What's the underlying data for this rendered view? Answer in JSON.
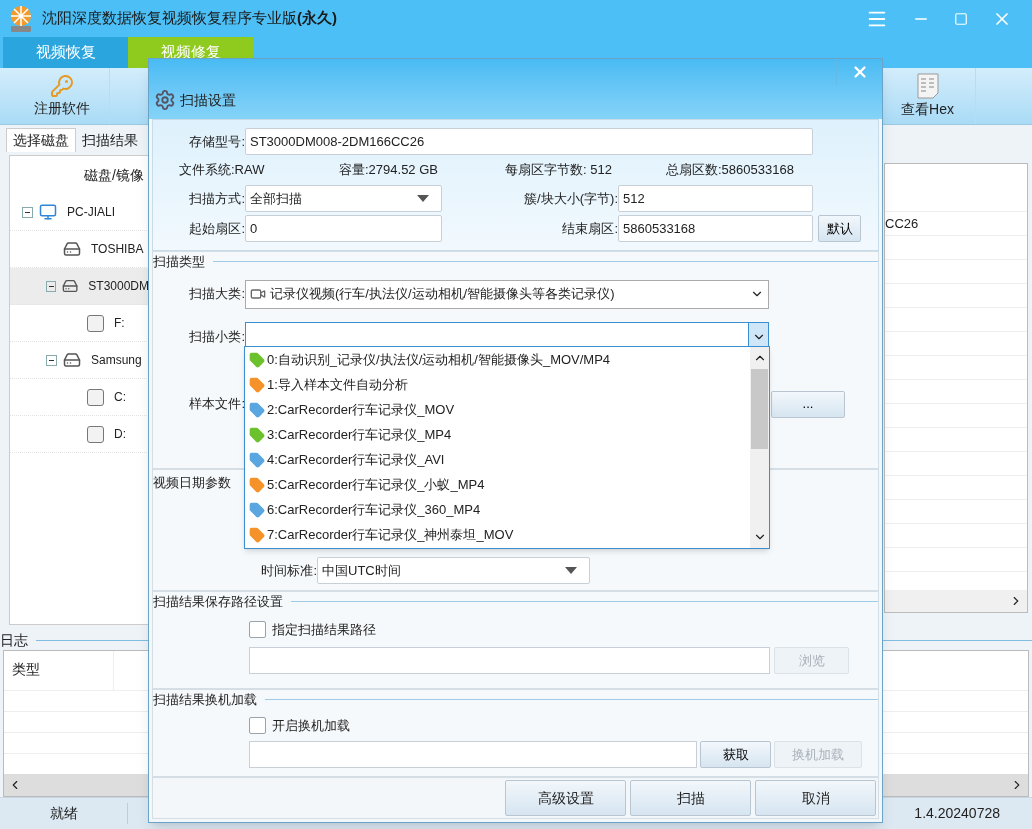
{
  "window": {
    "title": "沈阳深度数据恢复视频恢复程序专业版**(永久)**"
  },
  "main_tabs": [
    {
      "label": "视频恢复",
      "selected": false
    },
    {
      "label": "视频修复",
      "selected": true
    }
  ],
  "toolbar": [
    {
      "label": "注册软件",
      "kind": "keys"
    },
    {
      "label": "查看Hex",
      "kind": "hex"
    }
  ],
  "left_tabs": [
    {
      "label": "选择磁盘",
      "selected": true
    },
    {
      "label": "扫描结果",
      "selected": false
    }
  ],
  "tree": {
    "header": "磁盘/镜像",
    "items": [
      {
        "label": "PC-JIALI",
        "kind": "computer",
        "expanded": true,
        "selected": false,
        "children": [
          {
            "label": "TOSHIBA",
            "kind": "disk",
            "selected": false
          },
          {
            "label": "ST3000DM",
            "kind": "disk",
            "expanded": true,
            "selected": true,
            "children": [
              {
                "label": "F:",
                "kind": "volume",
                "selected": false
              }
            ]
          },
          {
            "label": "Samsung",
            "kind": "disk",
            "expanded": true,
            "selected": false,
            "children": [
              {
                "label": "C:",
                "kind": "volume",
                "selected": false
              },
              {
                "label": "D:",
                "kind": "volume",
                "selected": false
              }
            ]
          }
        ]
      }
    ]
  },
  "device_list": {
    "rows": [
      "CC26"
    ]
  },
  "log": {
    "title": "日志",
    "columns": [
      "类型"
    ]
  },
  "status_bar": {
    "status": "就绪",
    "version": "1.4.20240728"
  },
  "dialog": {
    "title": "扫描设置",
    "storage_model": {
      "label": "存储型号:",
      "value": "ST3000DM008-2DM166CC26"
    },
    "info": [
      "文件系统:RAW",
      "容量:2794.52 GB",
      "每扇区字节数: 512",
      "总扇区数:5860533168"
    ],
    "scan_mode": {
      "label": "扫描方式:",
      "value": "全部扫描"
    },
    "cluster_size": {
      "label": "簇/块大小(字节):",
      "value": "512"
    },
    "start_sector": {
      "label": "起始扇区:",
      "value": "0"
    },
    "end_sector": {
      "label": "结束扇区:",
      "value": "5860533168"
    },
    "default_button": "默认",
    "scan_type": {
      "title": "扫描类型",
      "category_label": "扫描大类:",
      "category_value": "记录仪视频(行车/执法仪/运动相机/智能摄像头等各类记录仪)",
      "subcategory_label": "扫描小类:",
      "open": true,
      "sample_label": "样本文件:",
      "sample_button": "...",
      "options": [
        {
          "label": "0:自动识别_记录仪/执法仪/运动相机/智能摄像头_MOV/MP4",
          "color": "#6cc22c"
        },
        {
          "label": "1:导入样本文件自动分析",
          "color": "#f5922a"
        },
        {
          "label": "2:CarRecorder行车记录仪_MOV",
          "color": "#5aa6e0"
        },
        {
          "label": "3:CarRecorder行车记录仪_MP4",
          "color": "#6cc22c"
        },
        {
          "label": "4:CarRecorder行车记录仪_AVI",
          "color": "#5aa6e0"
        },
        {
          "label": "5:CarRecorder行车记录仪_小蚁_MP4",
          "color": "#f5922a"
        },
        {
          "label": "6:CarRecorder行车记录仪_360_MP4",
          "color": "#5aa6e0"
        },
        {
          "label": "7:CarRecorder行车记录仪_神州泰坦_MOV",
          "color": "#f5922a"
        }
      ]
    },
    "date_params": {
      "title": "视频日期参数",
      "time_label": "时间标准:",
      "time_value": "中国UTC时间"
    },
    "save_path": {
      "title": "扫描结果保存路径设置",
      "checkbox": {
        "label": "指定扫描结果路径",
        "checked": false
      },
      "browse": {
        "label": "浏览",
        "disabled": true
      }
    },
    "transfer": {
      "title": "扫描结果换机加载",
      "checkbox": {
        "label": "开启换机加载",
        "checked": false
      },
      "fetch": {
        "label": "获取",
        "disabled": false
      },
      "load": {
        "label": "换机加载",
        "disabled": true
      }
    },
    "buttons": [
      "高级设置",
      "扫描",
      "取消"
    ]
  }
}
